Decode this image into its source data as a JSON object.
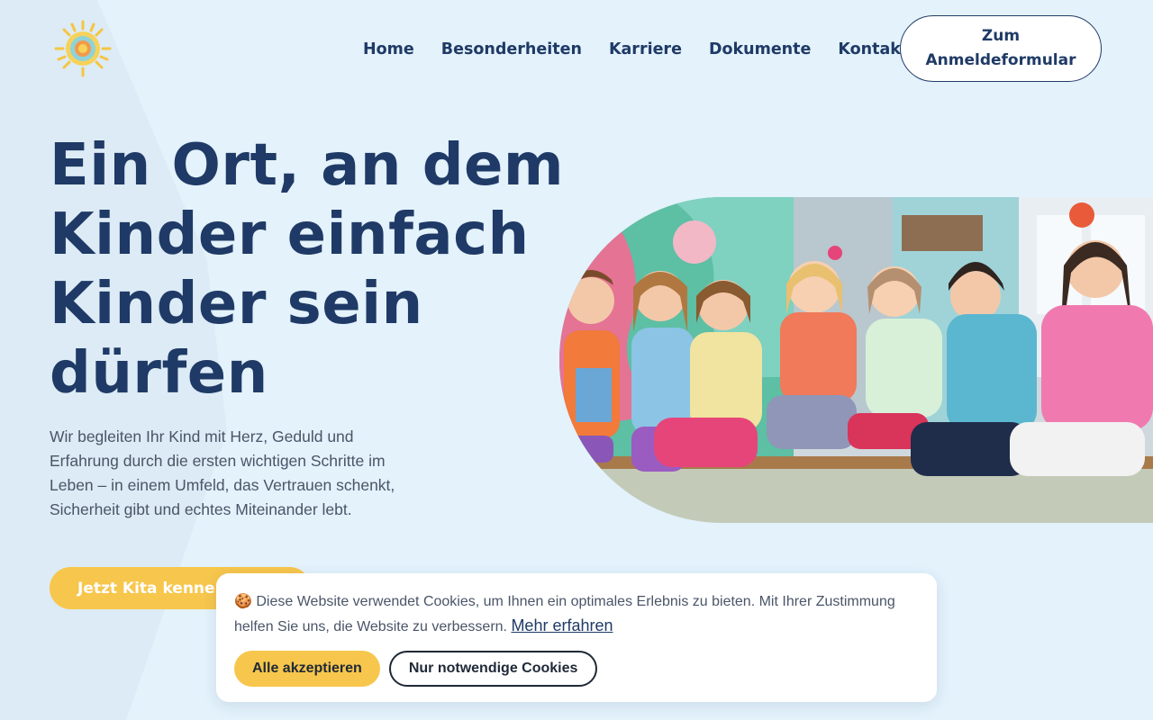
{
  "header": {
    "logo_icon": "sun-logo-icon",
    "nav": [
      {
        "label": "Home"
      },
      {
        "label": "Besonderheiten"
      },
      {
        "label": "Karriere"
      },
      {
        "label": "Dokumente"
      },
      {
        "label": "Kontakt"
      }
    ],
    "cta_label": "Zum Anmeldeformular"
  },
  "hero": {
    "title": "Ein Ort, an dem Kinder einfach Kinder sein dürfen",
    "text": "Wir begleiten Ihr Kind mit Herz, Geduld und Erfahrung durch die ersten wichtigen Schritte im Leben – in einem Umfeld, das Vertrauen schenkt, Sicherheit gibt und echtes Miteinander lebt.",
    "button_label": "Jetzt Kita kennenlernen",
    "photo_icon": "children-photo"
  },
  "cookie_banner": {
    "emoji": "🍪",
    "text": "Diese Website verwendet Cookies, um Ihnen ein optimales Erlebnis zu bieten. Mit Ihrer Zustimmung helfen Sie uns, die Website zu verbessern.",
    "link_label": "Mehr erfahren",
    "accept_label": "Alle akzeptieren",
    "necessary_label": "Nur notwendige Cookies"
  },
  "colors": {
    "background": "#e3f2fb",
    "primary": "#1f3a66",
    "accent": "#f7c64c"
  }
}
